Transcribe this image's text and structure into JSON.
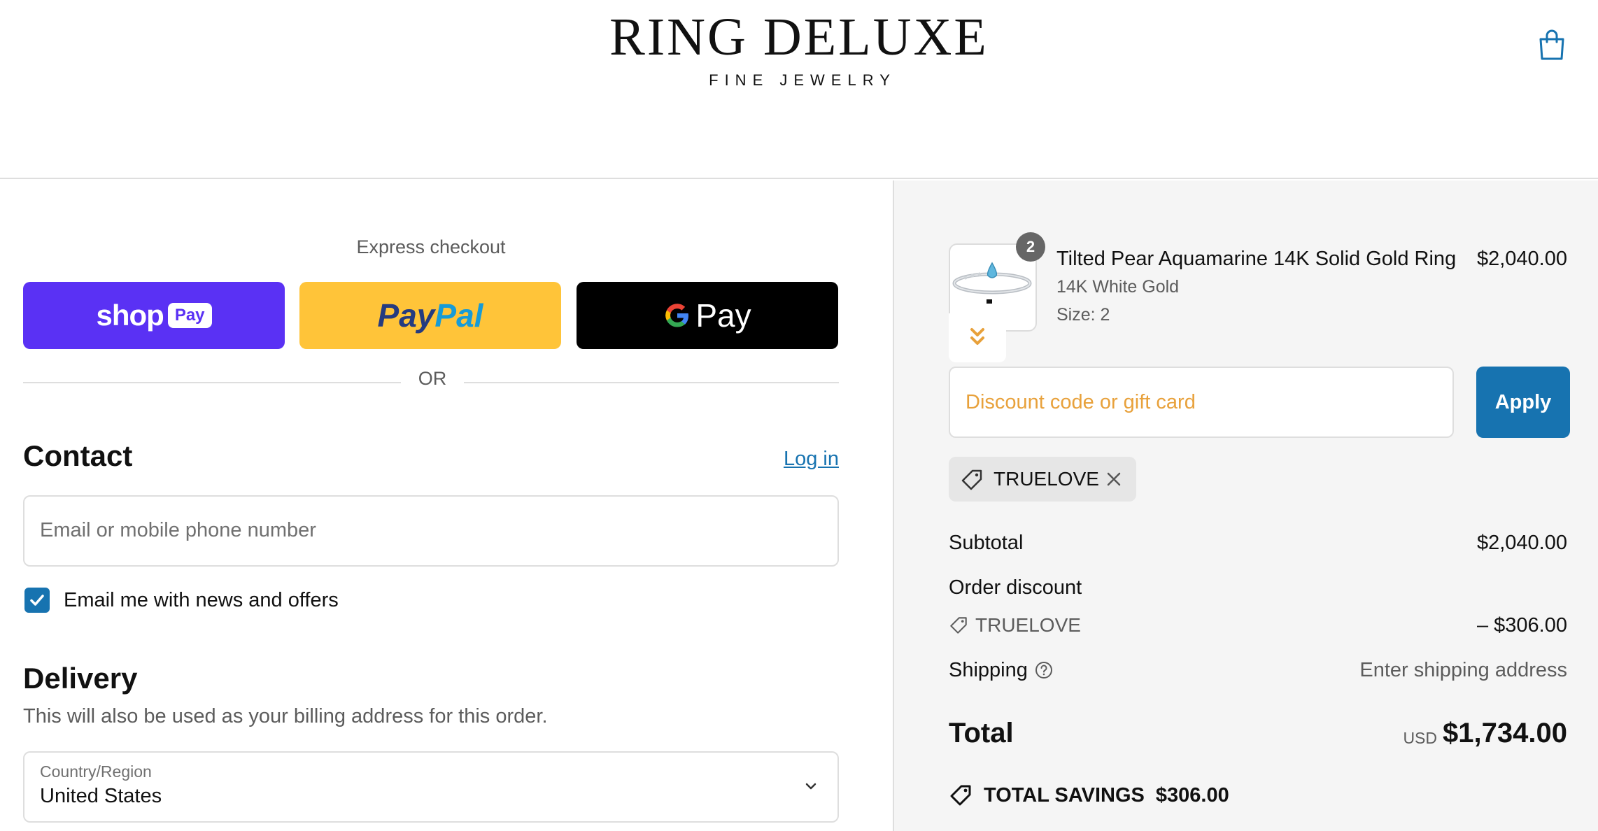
{
  "header": {
    "brand_name": "RING DELUXE",
    "brand_tagline": "FINE JEWELRY",
    "cart_icon": "shopping-bag-icon"
  },
  "express": {
    "title": "Express checkout",
    "shop_pay": {
      "word": "shop",
      "pill": "Pay",
      "color": "#5a31f4"
    },
    "paypal": {
      "part1": "Pay",
      "part2": "Pal",
      "color": "#ffc439"
    },
    "gpay": {
      "word": "Pay",
      "color": "#000000"
    },
    "or_text": "OR"
  },
  "contact": {
    "title": "Contact",
    "login_label": "Log in",
    "email_placeholder": "Email or mobile phone number",
    "newsletter_label": "Email me with news and offers",
    "newsletter_checked": true
  },
  "delivery": {
    "title": "Delivery",
    "subtitle": "This will also be used as your billing address for this order.",
    "country_label": "Country/Region",
    "country_value": "United States"
  },
  "order": {
    "product": {
      "name": "Tilted Pear Aquamarine 14K Solid Gold Ring",
      "price": "$2,040.00",
      "variant": "14K White Gold",
      "size": "Size: 2",
      "quantity": "2"
    },
    "discount": {
      "placeholder": "Discount code or gift card",
      "apply_label": "Apply",
      "applied_code": "TRUELOVE"
    },
    "summary": {
      "subtotal_label": "Subtotal",
      "subtotal_value": "$2,040.00",
      "discount_label": "Order discount",
      "discount_code": "TRUELOVE",
      "discount_value": "– $306.00",
      "shipping_label": "Shipping",
      "shipping_value": "Enter shipping address",
      "total_label": "Total",
      "total_currency": "USD",
      "total_value": "$1,734.00",
      "savings_label": "TOTAL SAVINGS",
      "savings_value": "$306.00"
    }
  },
  "colors": {
    "accent": "#1773b0",
    "placeholder_orange": "#e8a13b"
  }
}
